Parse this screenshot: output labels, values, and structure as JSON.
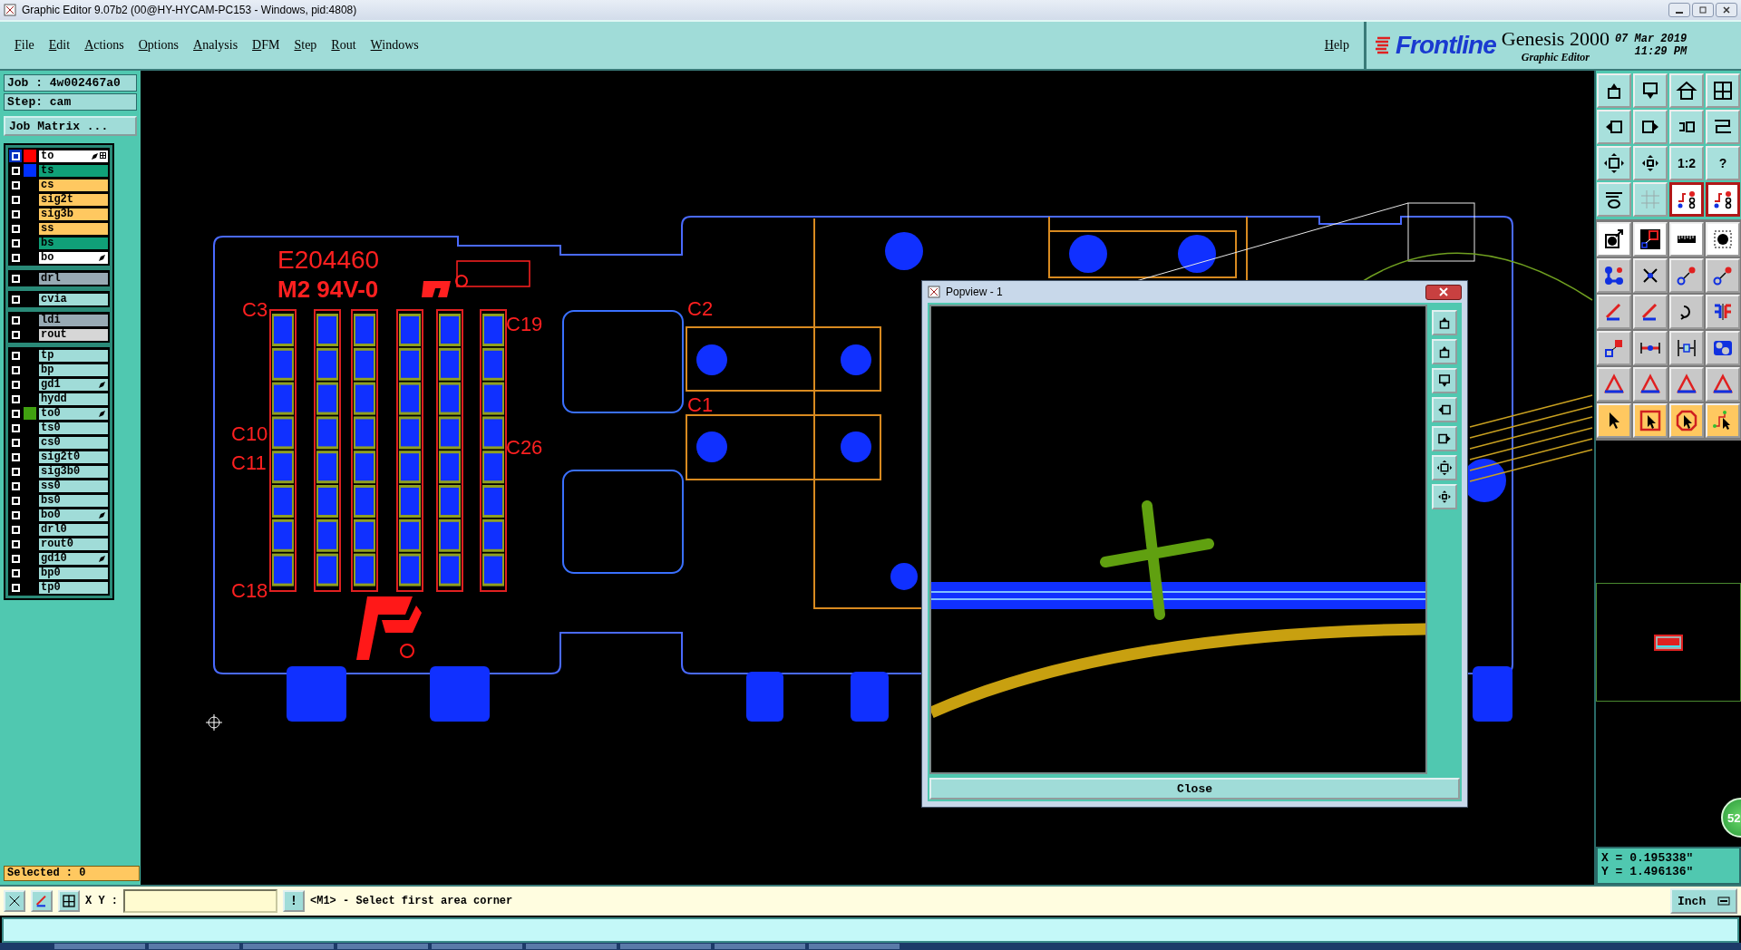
{
  "window": {
    "title": "Graphic Editor 9.07b2 (00@HY-HYCAM-PC153 - Windows, pid:4808)"
  },
  "menu": [
    "File",
    "Edit",
    "Actions",
    "Options",
    "Analysis",
    "DFM",
    "Step",
    "Rout",
    "Windows"
  ],
  "help": "Help",
  "brand": {
    "logo": "Frontline",
    "product": "Genesis 2000",
    "subtitle": "Graphic Editor",
    "date": "07 Mar 2019",
    "time": "11:29 PM"
  },
  "job": {
    "job": "Job : 4w002467a0",
    "step": "Step: cam",
    "matrix_button": "Job Matrix ..."
  },
  "layer_groups": [
    {
      "layers": [
        {
          "name": "to",
          "kind": "silk",
          "color": "#ff0000",
          "selected": true,
          "edit_mark": true
        },
        {
          "name": "ts",
          "kind": "mask",
          "color": "#0030ff",
          "selected": false,
          "edit_mark": false
        },
        {
          "name": "cs",
          "kind": "signal",
          "selected": false,
          "edit_mark": false
        },
        {
          "name": "sig2t",
          "kind": "signal",
          "selected": false,
          "edit_mark": false
        },
        {
          "name": "sig3b",
          "kind": "signal",
          "selected": false,
          "edit_mark": false
        },
        {
          "name": "ss",
          "kind": "signal",
          "selected": false,
          "edit_mark": false
        },
        {
          "name": "bs",
          "kind": "mask",
          "selected": false,
          "edit_mark": false
        },
        {
          "name": "bo",
          "kind": "silk",
          "selected": false,
          "edit_mark": true
        }
      ]
    },
    {
      "layers": [
        {
          "name": "drl",
          "kind": "drill",
          "selected": false,
          "edit_mark": false
        }
      ]
    },
    {
      "layers": [
        {
          "name": "cvia",
          "kind": "misc",
          "selected": false,
          "edit_mark": false
        }
      ]
    },
    {
      "layers": [
        {
          "name": "ldi",
          "kind": "drill",
          "selected": false,
          "edit_mark": false
        },
        {
          "name": "rout",
          "kind": "rout",
          "selected": false,
          "edit_mark": false
        }
      ]
    },
    {
      "layers": [
        {
          "name": "tp",
          "kind": "misc",
          "selected": false,
          "edit_mark": false
        },
        {
          "name": "bp",
          "kind": "misc",
          "selected": false,
          "edit_mark": false
        },
        {
          "name": "gd1",
          "kind": "misc",
          "selected": false,
          "edit_mark": true
        },
        {
          "name": "hydd",
          "kind": "misc",
          "selected": false,
          "edit_mark": false
        },
        {
          "name": "to0",
          "kind": "misc",
          "color": "#40a010",
          "selected": false,
          "edit_mark": true
        },
        {
          "name": "ts0",
          "kind": "misc",
          "selected": false,
          "edit_mark": false
        },
        {
          "name": "cs0",
          "kind": "misc",
          "selected": false,
          "edit_mark": false
        },
        {
          "name": "sig2t0",
          "kind": "misc",
          "selected": false,
          "edit_mark": false
        },
        {
          "name": "sig3b0",
          "kind": "misc",
          "selected": false,
          "edit_mark": false
        },
        {
          "name": "ss0",
          "kind": "misc",
          "selected": false,
          "edit_mark": false
        },
        {
          "name": "bs0",
          "kind": "misc",
          "selected": false,
          "edit_mark": false
        },
        {
          "name": "bo0",
          "kind": "misc",
          "selected": false,
          "edit_mark": true
        },
        {
          "name": "drl0",
          "kind": "misc",
          "selected": false,
          "edit_mark": false
        },
        {
          "name": "rout0",
          "kind": "misc",
          "selected": false,
          "edit_mark": false
        },
        {
          "name": "gd10",
          "kind": "misc",
          "selected": false,
          "edit_mark": true
        },
        {
          "name": "bp0",
          "kind": "misc",
          "selected": false,
          "edit_mark": false
        },
        {
          "name": "tp0",
          "kind": "misc",
          "selected": false,
          "edit_mark": false
        }
      ]
    }
  ],
  "selected_count": "Selected : 0",
  "board": {
    "marking": "E204460",
    "rating": "M2 94V-0",
    "designators": [
      "C3",
      "C10",
      "C11",
      "C18",
      "C19",
      "C26",
      "C2",
      "C1"
    ]
  },
  "popview": {
    "title": "Popview - 1",
    "close_button": "Close"
  },
  "toolbox": {
    "view_tools": [
      {
        "on": false
      },
      {
        "on": false
      },
      {
        "on": false
      },
      {
        "on": false
      },
      {
        "on": false
      },
      {
        "on": false
      },
      {
        "on": false
      },
      {
        "on": false
      },
      {
        "on": false
      },
      {
        "on": false
      },
      {
        "on": false,
        "label": "1:2"
      },
      {
        "on": false,
        "label": "?"
      },
      {
        "on": false
      },
      {
        "on": false
      },
      {
        "on": true
      },
      {
        "on": true
      }
    ],
    "edit_tools": [
      {
        "on": true
      },
      {
        "on": true
      },
      {
        "on": true
      },
      {
        "on": true
      },
      {
        "on": false
      },
      {
        "on": false
      },
      {
        "on": false
      },
      {
        "on": false
      },
      {
        "on": false
      },
      {
        "on": false
      },
      {
        "on": false
      },
      {
        "on": false
      },
      {
        "on": false
      },
      {
        "on": false
      },
      {
        "on": false
      },
      {
        "on": false
      },
      {
        "on": false
      },
      {
        "on": false
      },
      {
        "on": false
      },
      {
        "on": false
      }
    ]
  },
  "coordinates": {
    "x": "X = 0.195338\"",
    "y": "Y = 1.496136\""
  },
  "badge": "52",
  "command_bar": {
    "xy_label": "X Y :",
    "bang": "!",
    "message": "<M1> - Select first area corner",
    "units": "Inch"
  }
}
